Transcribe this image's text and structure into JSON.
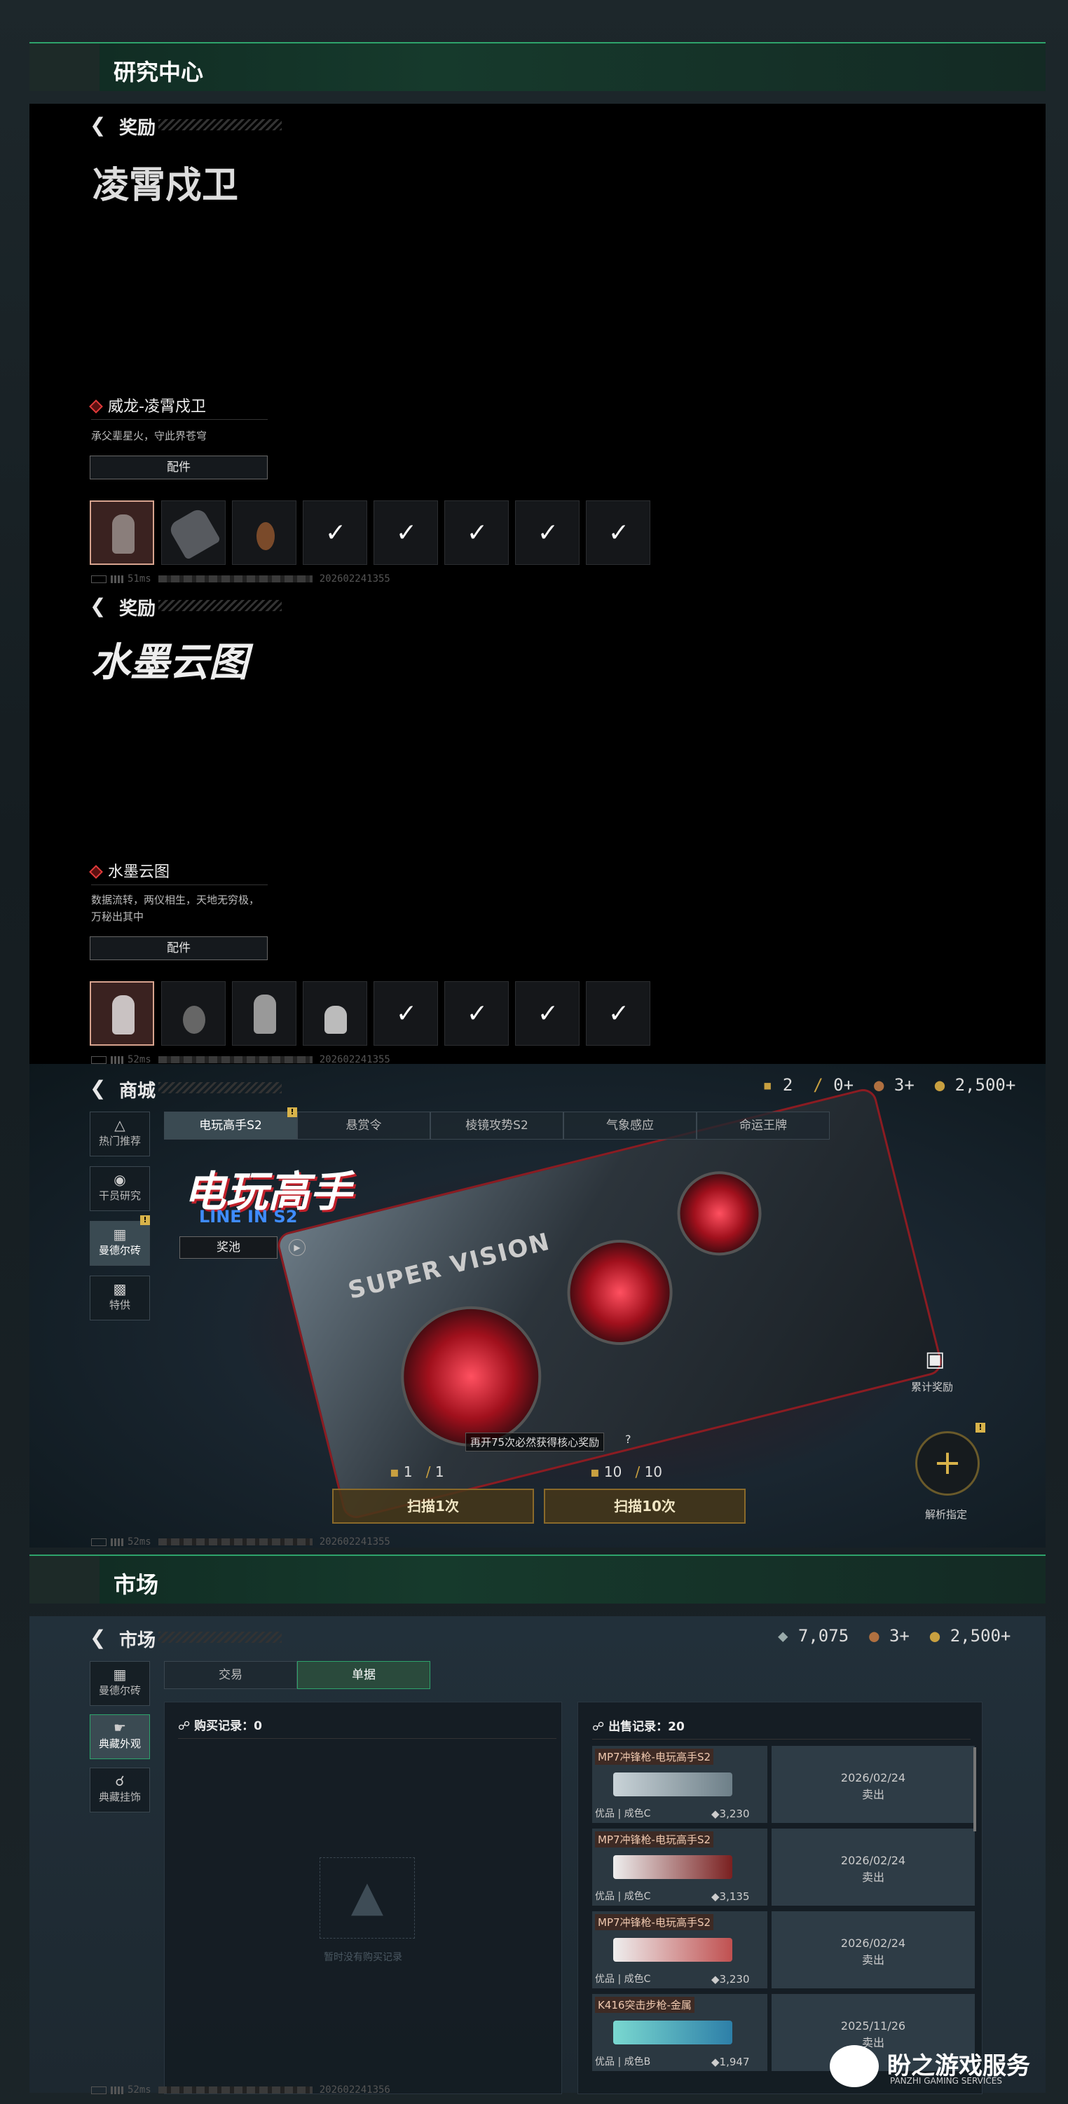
{
  "section1": {
    "title": "研究中心"
  },
  "reward1": {
    "subtitle": "奖励",
    "logo_text": "凌霄戍卫",
    "name": "威龙-凌霄戍卫",
    "desc": "承父辈星火，守此界苍穹",
    "tag": "配件",
    "status_ms": "51ms",
    "status_id": "202602241355"
  },
  "reward2": {
    "subtitle": "奖励",
    "logo_text": "水墨云图",
    "name": "水墨云图",
    "desc_line1": "数据流转，两仪相生，天地无穷极，",
    "desc_line2": "万秘出其中",
    "tag": "配件",
    "status_ms": "52ms",
    "status_id": "202602241355"
  },
  "shop": {
    "title": "商城",
    "currency": {
      "a": "2",
      "b": "0+",
      "c": "3+",
      "d": "2,500+"
    },
    "tabs": [
      "电玩高手S2",
      "悬赏令",
      "棱镜攻势S2",
      "气象感应",
      "命运王牌"
    ],
    "side": [
      "热门推荐",
      "干员研究",
      "曼德尔砖",
      "特供"
    ],
    "banner_title": "电玩高手",
    "banner_sub": "LINE IN S2",
    "pool_btn": "奖池",
    "gpu_text": "SUPER VISION",
    "cum_reward": "累计奖励",
    "analyze": "解析指定",
    "hint": "再开75次必然获得核心奖励",
    "hint_q": "?",
    "cost1a": "1",
    "cost1b": "1",
    "cost10a": "10",
    "cost10b": "10",
    "scan1": "扫描1次",
    "scan10": "扫描10次",
    "status_ms": "52ms",
    "status_id": "202602241355"
  },
  "section2": {
    "title": "市场"
  },
  "market": {
    "title": "市场",
    "currency": {
      "a": "7,075",
      "b": "3+",
      "c": "2,500+"
    },
    "tabs": [
      "交易",
      "单据"
    ],
    "side": [
      "曼德尔砖",
      "典藏外观",
      "典藏挂饰"
    ],
    "buy_title": "购买记录：0",
    "empty_text": "暂时没有购买记录",
    "sell_title": "出售记录：20",
    "sells": [
      {
        "name": "MP7冲锋枪-电玩高手S2",
        "quality": "优品 | 成色C",
        "price": "3,230",
        "date": "2026/02/24",
        "state": "卖出"
      },
      {
        "name": "MP7冲锋枪-电玩高手S2",
        "quality": "优品 | 成色C",
        "price": "3,135",
        "date": "2026/02/24",
        "state": "卖出"
      },
      {
        "name": "MP7冲锋枪-电玩高手S2",
        "quality": "优品 | 成色C",
        "price": "3,230",
        "date": "2026/02/24",
        "state": "卖出"
      },
      {
        "name": "K416突击步枪-金属",
        "quality": "优品 | 成色B",
        "price": "1,947",
        "date": "2025/11/26",
        "state": "卖出"
      }
    ],
    "status_ms": "52ms",
    "status_id": "202602241356"
  },
  "watermark": {
    "main": "盼之游戏服务",
    "sub": "PANZHI GAMING SERVICES"
  }
}
